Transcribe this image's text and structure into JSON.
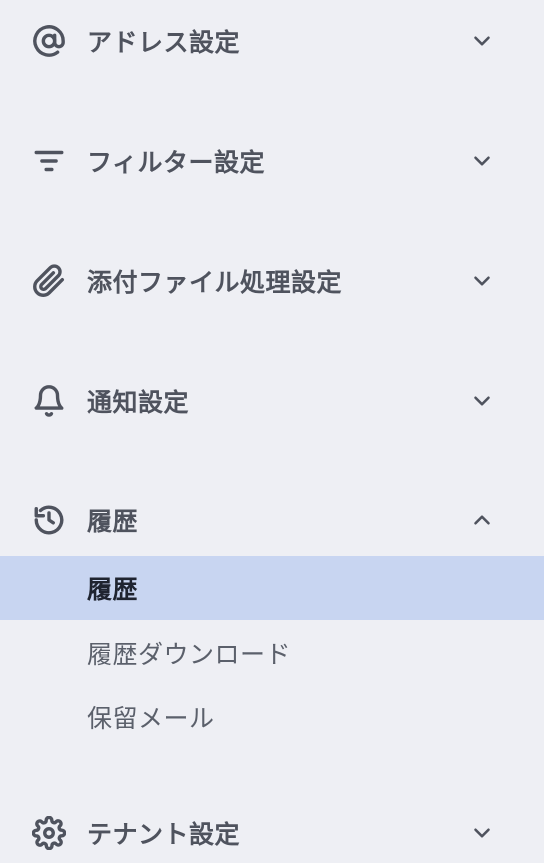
{
  "sections": [
    {
      "label": "アドレス設定",
      "icon": "at-sign-icon",
      "expanded": false
    },
    {
      "label": "フィルター設定",
      "icon": "filter-icon",
      "expanded": false
    },
    {
      "label": "添付ファイル処理設定",
      "icon": "paperclip-icon",
      "expanded": false
    },
    {
      "label": "通知設定",
      "icon": "bell-icon",
      "expanded": false
    },
    {
      "label": "履歴",
      "icon": "history-icon",
      "expanded": true,
      "items": [
        {
          "label": "履歴",
          "active": true
        },
        {
          "label": "履歴ダウンロード",
          "active": false
        },
        {
          "label": "保留メール",
          "active": false
        }
      ]
    },
    {
      "label": "テナント設定",
      "icon": "gear-icon",
      "expanded": false
    }
  ],
  "colors": {
    "background": "#eeeff4",
    "active_background": "#c8d5f1",
    "header_text": "#4f535e",
    "active_text": "#1f2430"
  }
}
